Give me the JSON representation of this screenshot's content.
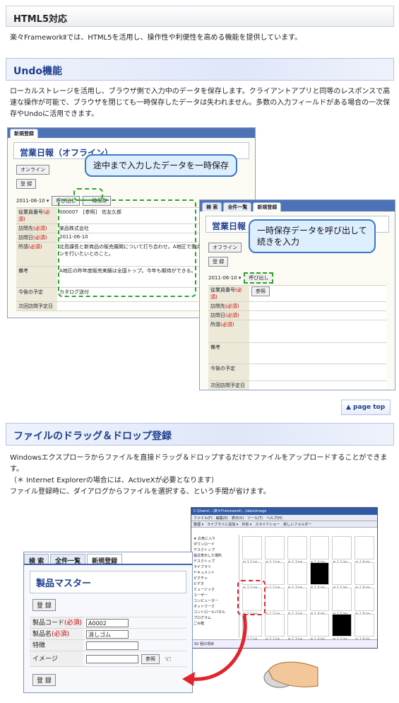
{
  "section_html5": {
    "title": "HTML5対応",
    "desc": "楽々FrameworkⅡでは、HTML5を活用し、操作性や利便性を高める機能を提供しています。"
  },
  "section_undo": {
    "title": "Undo機能",
    "desc": "ローカルストレージを活用し、ブラウザ側で入力中のデータを保存します。クライアントアプリと同等のレスポンスで高速な操作が可能で、ブラウザを閉じても一時保存したデータは失われません。多数の入力フィールドがある場合の一次保存やUndoに活用できます。",
    "bubble1": "途中まで入力したデータを一時保存",
    "bubble2_line1": "一時保存データを呼び出して",
    "bubble2_line2": "続きを入力"
  },
  "screen1": {
    "tab": "新規登録",
    "form_title": "営業日報（オフライン）",
    "online_btn": "オンライン",
    "register_btn": "登 録",
    "date": "2011-06-10 ▾",
    "call_btn": "呼び出し",
    "temp_btn": "一時保存",
    "rows": [
      {
        "label": "従業員番号",
        "req": "(必須)",
        "value": "000007　[参照]　佐友久郎"
      },
      {
        "label": "訪問先",
        "req": "(必須)",
        "value": "楽品株式会社"
      },
      {
        "label": "訪問日",
        "req": "(必須)",
        "value": "2011-06-10"
      },
      {
        "label": "所感",
        "req": "(必須)",
        "value": "北島課長と新商品の販売展開について打ち合わせ。A地区で重点的にプロモーションを行いたいとのこと。"
      },
      {
        "label": "備考",
        "req": "",
        "value": "A地区の昨年度販売実績は全国トップ。今年も期待ができる。"
      },
      {
        "label": "今後の予定",
        "req": "",
        "value": "カタログ送付"
      },
      {
        "label": "次回訪問予定日",
        "req": "",
        "value": ""
      }
    ]
  },
  "screen2": {
    "tabs": [
      "検 索",
      "全件一覧",
      "新規登録"
    ],
    "form_title": "営業日報",
    "online_btn": "オフライン",
    "register_btn": "登 録",
    "date": "2011-06-10 ▾",
    "call_btn": "呼び出し",
    "ref_btn": "参照",
    "rows": [
      {
        "label": "従業員番号",
        "req": "(必須)"
      },
      {
        "label": "訪問先",
        "req": "(必須)"
      },
      {
        "label": "訪問日",
        "req": "(必須)"
      },
      {
        "label": "所感",
        "req": "(必須)"
      },
      {
        "label": "備考",
        "req": ""
      },
      {
        "label": "今後の予定",
        "req": ""
      },
      {
        "label": "次回訪問予定日",
        "req": ""
      }
    ]
  },
  "pagetop": "▲ page top",
  "section_dnd": {
    "title": "ファイルのドラッグ＆ドロップ登録",
    "desc1": "Windowsエクスプローラからファイルを直接ドラッグ＆ドロップするだけでファイルをアップロードすることができます。",
    "desc2": "（＊ Internet Explorerの場合には、ActiveXが必要となります）",
    "desc3": "ファイル登録時に、ダイアログからファイルを選択する、という手間が省けます。"
  },
  "explorer": {
    "title": "C:\\Users\\...\\楽々Framework\\...\\data\\image",
    "menu": "ファイル(F)　編集(E)　表示(V)　ツール(T)　ヘルプ(H)",
    "toolbar": "整理 ▾　ライブラリに追加 ▾　共有 ▾　スライドショー　新しいフォルダー",
    "tree": [
      "★ お気に入り",
      "ダウンロード",
      "デスクトップ",
      "最近表示した場所",
      "",
      "デスクトップ",
      "ライブラリ",
      "ドキュメント",
      "ピクチャ",
      "ビデオ",
      "ミュージック",
      "ユーザー",
      "コンピューター",
      "ネットワーク",
      "コントロールパネル",
      "プログラム",
      "ごみ箱"
    ],
    "thumb_labels": [
      "m_1_1.jpe",
      "m_1_2.jpe",
      "m_1_3.jpe",
      "m_1_4.jpe",
      "m_1_5.jpe",
      "m_1_6.jpe"
    ],
    "status": "92 個の項目"
  },
  "product": {
    "tabs": [
      "検 索",
      "全件一覧",
      "新規登録"
    ],
    "title": "製品マスター",
    "register_btn": "登 録",
    "rows": [
      {
        "label": "製品コード",
        "req": "(必須)",
        "value": "A0002"
      },
      {
        "label": "製品名",
        "req": "(必須)",
        "value": "消しゴム"
      },
      {
        "label": "特徴",
        "req": "",
        "value": ""
      },
      {
        "label": "イメージ",
        "req": "",
        "value": ""
      }
    ],
    "ref_btn": "参照",
    "register_btn2": "登 録"
  }
}
